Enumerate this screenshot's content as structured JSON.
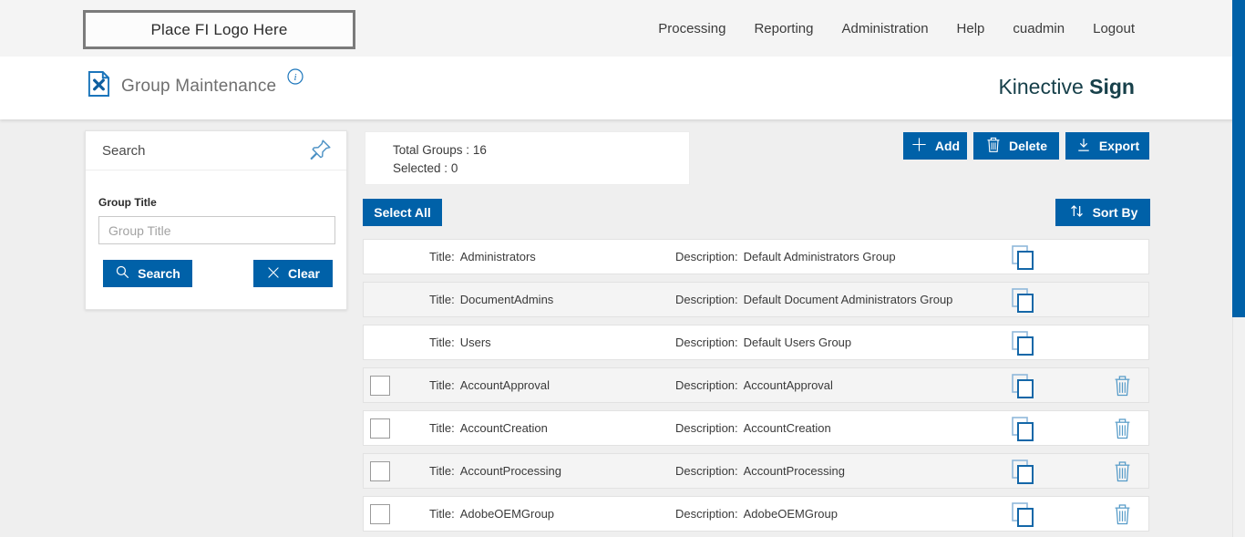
{
  "colors": {
    "accent_blue": "#0061A8",
    "brand_teal": "#17404A",
    "icon_blue": "#1B75BB",
    "row_icon_blue": "#4A90C4",
    "topbar_bg": "#F4F4F4",
    "content_bg": "#EFEFEF"
  },
  "topbar": {
    "logo_placeholder": "Place FI Logo Here",
    "nav": [
      "Processing",
      "Reporting",
      "Administration",
      "Help",
      "cuadmin",
      "Logout"
    ]
  },
  "header": {
    "title": "Group Maintenance",
    "brand_first": "Kinective",
    "brand_second": "Sign"
  },
  "search_panel": {
    "title": "Search",
    "field_label": "Group Title",
    "input_value": "",
    "input_placeholder": "Group Title",
    "search_button": "Search",
    "clear_button": "Clear"
  },
  "summary": {
    "total_label": "Total Groups :",
    "total_value": "16",
    "selected_label": "Selected :",
    "selected_value": "0"
  },
  "actions": {
    "add": "Add",
    "delete": "Delete",
    "export": "Export",
    "select_all": "Select All",
    "sort_by": "Sort By"
  },
  "groups": {
    "title_prefix": "Title:",
    "description_prefix": "Description:",
    "rows": [
      {
        "title": "Administrators",
        "description": "Default Administrators Group",
        "deletable": false
      },
      {
        "title": "DocumentAdmins",
        "description": "Default Document Administrators Group",
        "deletable": false
      },
      {
        "title": "Users",
        "description": "Default Users Group",
        "deletable": false
      },
      {
        "title": "AccountApproval",
        "description": "AccountApproval",
        "deletable": true
      },
      {
        "title": "AccountCreation",
        "description": "AccountCreation",
        "deletable": true
      },
      {
        "title": "AccountProcessing",
        "description": "AccountProcessing",
        "deletable": true
      },
      {
        "title": "AdobeOEMGroup",
        "description": "AdobeOEMGroup",
        "deletable": true
      }
    ]
  }
}
